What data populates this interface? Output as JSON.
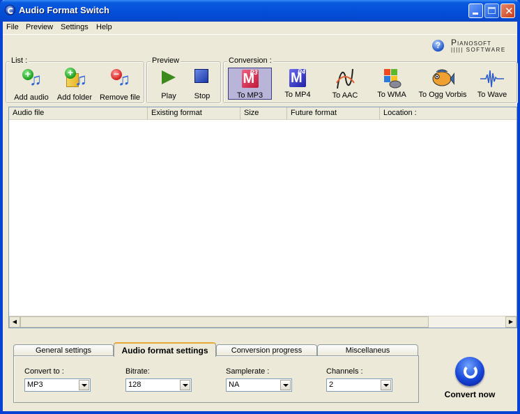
{
  "window": {
    "title": "Audio Format Switch"
  },
  "menu": [
    "File",
    "Preview",
    "Settings",
    "Help"
  ],
  "logo": {
    "brand": "Pianosoft",
    "sub": "SOFTWARE",
    "help_icon": "help-icon"
  },
  "toolbar": {
    "list": {
      "label": "List :",
      "buttons": [
        "Add audio",
        "Add folder",
        "Remove file"
      ]
    },
    "preview": {
      "label": "Preview",
      "buttons": [
        "Play",
        "Stop"
      ]
    },
    "conversion": {
      "label": "Conversion :",
      "buttons": [
        "To MP3",
        "To MP4",
        "To AAC",
        "To WMA",
        "To Ogg Vorbis",
        "To Wave"
      ],
      "active": "To MP3"
    }
  },
  "file_list": {
    "columns": [
      "Audio file",
      "Existing format",
      "Size",
      "Future format",
      "Location :"
    ],
    "rows": []
  },
  "tabs": {
    "items": [
      "General settings",
      "Audio format settings",
      "Conversion progress",
      "Miscellaneus"
    ],
    "active": "Audio format settings"
  },
  "settings": {
    "convert_to": {
      "label": "Convert to :",
      "value": "MP3"
    },
    "bitrate": {
      "label": "Bitrate:",
      "value": "128"
    },
    "samplerate": {
      "label": "Samplerate :",
      "value": "NA"
    },
    "channels": {
      "label": "Channels :",
      "value": "2"
    }
  },
  "convert_now": {
    "label": "Convert now"
  },
  "colors": {
    "titlebar": "#0450d9",
    "face": "#ece9d8",
    "active_tool": "#b8b5d8",
    "mp3": "#d8304a",
    "mp4": "#3a3ad0"
  }
}
